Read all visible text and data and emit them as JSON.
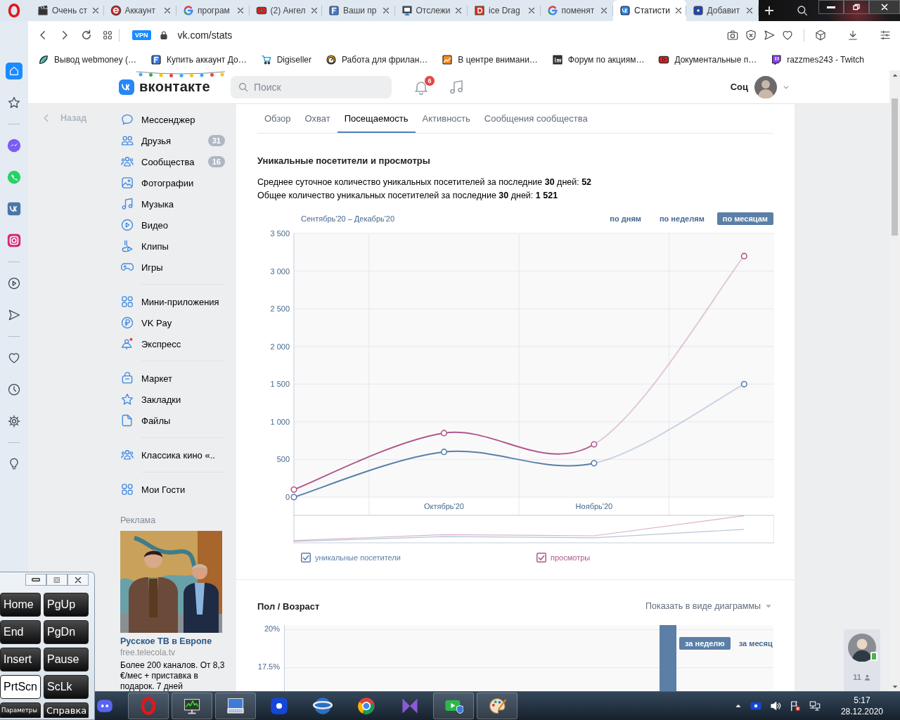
{
  "browser": {
    "tabs": [
      {
        "title": "Очень ст",
        "selected": false
      },
      {
        "title": "Аккаунт",
        "selected": false
      },
      {
        "title": "програм",
        "selected": false
      },
      {
        "title": "(2) Ангел",
        "selected": false
      },
      {
        "title": "Ваши пр",
        "selected": false
      },
      {
        "title": "Отслежи",
        "selected": false
      },
      {
        "title": "ice Drag",
        "selected": false
      },
      {
        "title": "поменят",
        "selected": false
      },
      {
        "title": "Статисти",
        "selected": true
      },
      {
        "title": "Добавит",
        "selected": false
      }
    ],
    "address": {
      "vpn": "VPN",
      "url": "vk.com/stats"
    },
    "bookmarks": [
      "Вывод webmoney (…",
      "Купить аккаунт До…",
      "Digiseller",
      "Работа для фрилан…",
      "В центре внимани…",
      "Форум по акциям…",
      "Документальные п…",
      "razzmes243 - Twitch"
    ]
  },
  "header": {
    "logo": "вконтакте",
    "search": {
      "placeholder": "Поиск"
    },
    "notifications": "6",
    "user": "Соц"
  },
  "back": "Назад",
  "menu_groups": [
    [
      {
        "label": "Мессенджер"
      },
      {
        "label": "Друзья",
        "count": "31"
      },
      {
        "label": "Сообщества",
        "count": "16"
      },
      {
        "label": "Фотографии"
      },
      {
        "label": "Музыка"
      },
      {
        "label": "Видео"
      },
      {
        "label": "Клипы"
      },
      {
        "label": "Игры"
      }
    ],
    [
      {
        "label": "Мини-приложения"
      },
      {
        "label": "VK Pay"
      },
      {
        "label": "Экспресс"
      }
    ],
    [
      {
        "label": "Маркет"
      },
      {
        "label": "Закладки"
      },
      {
        "label": "Файлы"
      }
    ],
    [
      {
        "label": "Классика кино «.."
      }
    ],
    [
      {
        "label": "Мои Гости"
      }
    ]
  ],
  "ad": {
    "label": "Реклама",
    "kind": "picture",
    "title": "Русское ТВ в Европе",
    "domain": "free.telecola.tv",
    "text": "Более 200 каналов. От 8,3 €/мес + приставка в подарок. 7 дней"
  },
  "stats": {
    "tabs": [
      {
        "label": "Обзор",
        "selected": false
      },
      {
        "label": "Охват",
        "selected": false
      },
      {
        "label": "Посещаемость",
        "selected": true
      },
      {
        "label": "Активность",
        "selected": false
      },
      {
        "label": "Сообщения сообщества",
        "selected": false
      }
    ],
    "title": "Уникальные посетители и просмотры",
    "lines": [
      "Среднее суточное количество уникальных посетителей за последние **30** дней: **52**",
      "Общее количество уникальных посетителей за последние **30** дней: **1 521**"
    ],
    "period": "Сентябрь'20 – Декабрь'20",
    "granularity": [
      {
        "label": "по дням",
        "selected": false
      },
      {
        "label": "по неделям",
        "selected": false
      },
      {
        "label": "по месяцам",
        "selected": true
      }
    ],
    "chart_data": {
      "type": "line",
      "grid": true,
      "categories": [
        null,
        "Октябрь'20",
        "Ноябрь'20",
        null
      ],
      "ylim": [
        0,
        3500
      ],
      "yticks": [
        {
          "value": 0,
          "label": "0"
        },
        {
          "value": 500,
          "label": "500"
        },
        {
          "value": 1000,
          "label": "1 000"
        },
        {
          "value": 1500,
          "label": "1 500"
        },
        {
          "value": 2000,
          "label": "2 000"
        },
        {
          "value": 2500,
          "label": "2 500"
        },
        {
          "value": 3000,
          "label": "3 000"
        },
        {
          "value": 3500,
          "label": "3 500"
        }
      ],
      "series": [
        {
          "name": "уникальные посетители",
          "color": "#5a7fa8",
          "marker": true,
          "values": [
            0,
            600,
            450,
            1500
          ]
        },
        {
          "name": "просмотры",
          "color": "#b0578a",
          "marker": true,
          "values": [
            100,
            850,
            700,
            3200
          ]
        }
      ]
    },
    "legend": [
      {
        "checked": true
      },
      {
        "checked": true
      }
    ]
  },
  "demographics": {
    "title": "Пол / Возраст",
    "view_toggle": "Показать в виде диаграммы",
    "y_labels": [
      "20%",
      "17.5%"
    ],
    "periods": [
      {
        "label": "за неделю",
        "selected": true
      },
      {
        "label": "за месяц",
        "selected": false
      }
    ]
  },
  "friends_widget": {
    "count": "11"
  },
  "keyboard": {
    "keys": [
      {
        "label": "Home",
        "active": false
      },
      {
        "label": "PgUp",
        "active": false
      },
      {
        "label": "End",
        "active": false
      },
      {
        "label": "PgDn",
        "active": false
      },
      {
        "label": "Insert",
        "active": false
      },
      {
        "label": "Pause",
        "active": false
      },
      {
        "label": "PrtScn",
        "active": true
      },
      {
        "label": "ScLk",
        "active": false
      }
    ],
    "buttons": [
      "Параметры",
      "Справка"
    ]
  },
  "taskbar": {
    "time": "5:17",
    "date": "28.12.2020"
  }
}
